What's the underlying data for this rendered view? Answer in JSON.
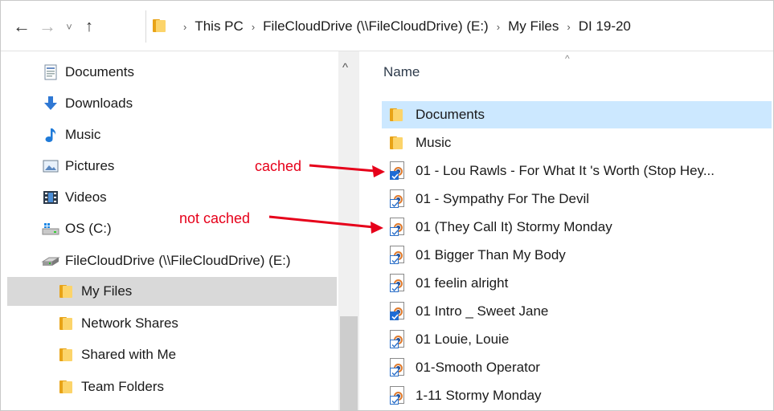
{
  "addressbar": {
    "back_glyph": "←",
    "forward_glyph": "→",
    "history_glyph": "˅",
    "up_glyph": "↑",
    "breadcrumbs": [
      "This PC",
      "FileCloudDrive (\\\\FileCloudDrive) (E:)",
      "My Files",
      "DI 19-20"
    ],
    "separator": "›"
  },
  "navpane": {
    "items": [
      {
        "label": "Documents",
        "icon": "documents-icon"
      },
      {
        "label": "Downloads",
        "icon": "download-arrow-icon"
      },
      {
        "label": "Music",
        "icon": "music-note-icon"
      },
      {
        "label": "Pictures",
        "icon": "pictures-icon"
      },
      {
        "label": "Videos",
        "icon": "videos-icon"
      },
      {
        "label": "OS (C:)",
        "icon": "os-drive-icon"
      },
      {
        "label": "FileCloudDrive (\\\\FileCloudDrive) (E:)",
        "icon": "network-drive-icon"
      },
      {
        "label": "My Files",
        "icon": "folder-icon",
        "selected": true
      },
      {
        "label": "Network Shares",
        "icon": "folder-icon"
      },
      {
        "label": "Shared with Me",
        "icon": "folder-icon"
      },
      {
        "label": "Team Folders",
        "icon": "folder-icon"
      }
    ],
    "scroll_up_glyph": "^"
  },
  "content": {
    "column_header": "Name",
    "sort_glyph": "^",
    "files": [
      {
        "name": "Documents",
        "type": "folder",
        "selected": true
      },
      {
        "name": "Music",
        "type": "folder"
      },
      {
        "name": "01 - Lou Rawls - For What It 's Worth (Stop Hey...",
        "type": "audio",
        "cached": true
      },
      {
        "name": "01 - Sympathy For The Devil",
        "type": "audio",
        "cached": false
      },
      {
        "name": "01 (They Call It) Stormy Monday",
        "type": "audio",
        "cached": false
      },
      {
        "name": "01 Bigger Than My Body",
        "type": "audio",
        "cached": false
      },
      {
        "name": "01 feelin alright",
        "type": "audio",
        "cached": false
      },
      {
        "name": "01 Intro _ Sweet Jane",
        "type": "audio",
        "cached": true
      },
      {
        "name": "01 Louie, Louie",
        "type": "audio",
        "cached": false
      },
      {
        "name": "01-Smooth Operator",
        "type": "audio",
        "cached": false
      },
      {
        "name": "1-11 Stormy Monday",
        "type": "audio",
        "cached": false
      }
    ]
  },
  "annotations": {
    "cached": "cached",
    "not_cached": "not cached",
    "color": "#e6001a"
  },
  "colors": {
    "selected_row": "#cce8ff",
    "nav_selected": "#d9d9d9",
    "folder": "#fcd46a"
  }
}
